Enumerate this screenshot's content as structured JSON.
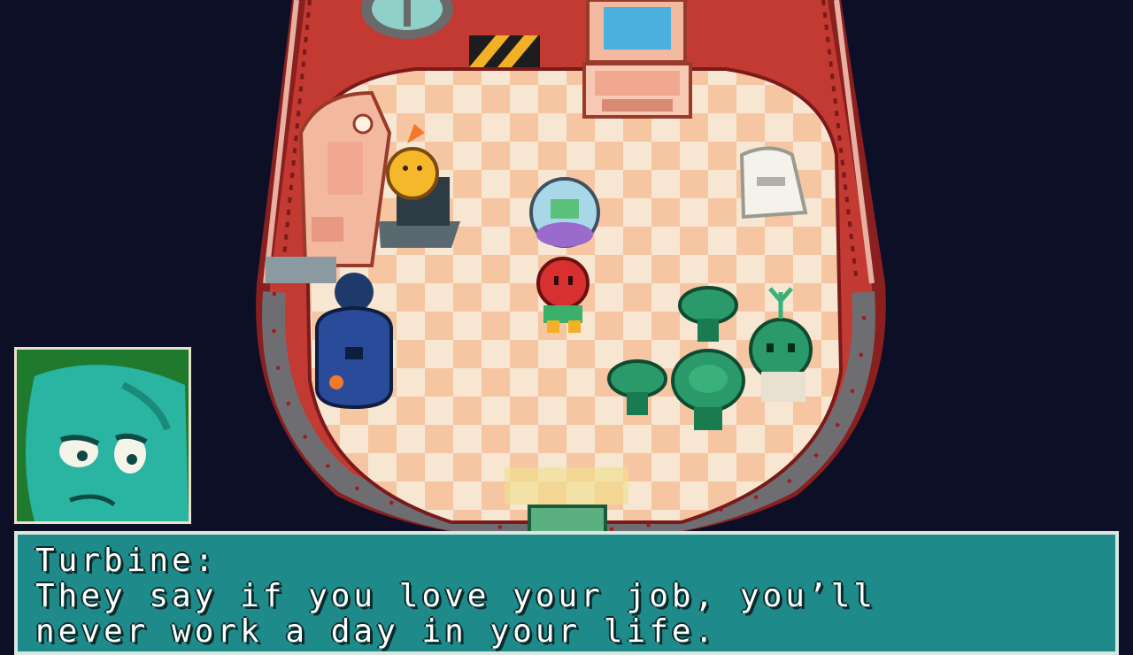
{
  "dialog": {
    "speaker": "Turbine:",
    "line1": "They say if you love your job, you’ll",
    "line2": "never work a day in your life."
  },
  "portrait": {
    "character_icon": "turbine-sad-face-icon"
  },
  "colors": {
    "background": "#0d0f26",
    "hull": "#b8322c",
    "floor_light": "#f6e6d2",
    "floor_tile": "#f6c6a2",
    "dialog_box": "#1f8a8a",
    "portrait_bg": "#1f7a2e"
  }
}
